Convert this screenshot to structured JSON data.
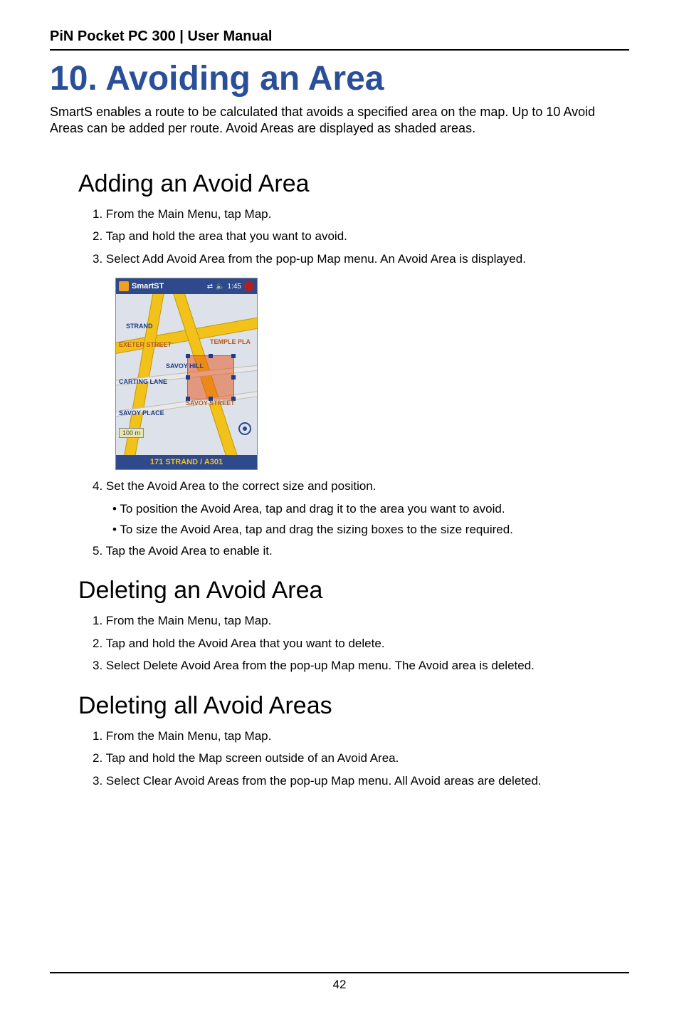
{
  "header": "PiN Pocket PC 300 | User Manual",
  "chapter_title": "10. Avoiding an Area",
  "intro": "SmartS enables a route to be calculated that avoids a specified area on the map. Up to 10 Avoid Areas can be added per route. Avoid Areas are displayed as shaded areas.",
  "sections": {
    "adding": {
      "title": "Adding an Avoid Area",
      "steps": [
        "1. From the Main Menu, tap Map.",
        "2. Tap and hold the area that you want to avoid.",
        "3. Select Add Avoid Area from the pop-up Map menu. An Avoid Area is displayed.",
        "4. Set the Avoid Area to the correct size and position.",
        "5. Tap the Avoid Area to enable it."
      ],
      "substeps": [
        "• To position the Avoid Area, tap and drag it to the area you want to avoid.",
        "• To size the Avoid Area, tap and drag the sizing boxes to the size required."
      ]
    },
    "deleting": {
      "title": "Deleting an Avoid Area",
      "steps": [
        "1. From the Main Menu, tap Map.",
        "2. Tap and hold the Avoid Area that you want to delete.",
        "3. Select Delete Avoid Area from the pop-up Map menu. The Avoid area is deleted."
      ]
    },
    "deleting_all": {
      "title": "Deleting all Avoid Areas",
      "steps": [
        "1. From the Main Menu, tap Map.",
        "2. Tap and hold the Map screen outside of an Avoid Area.",
        "3. Select Clear Avoid Areas from the pop-up Map menu. All Avoid areas are deleted."
      ]
    }
  },
  "screenshot": {
    "app_title": "SmartST",
    "clock": "1:45",
    "status_label": "A301",
    "scale_label": "100 m",
    "bottom_bar": "171 STRAND / A301",
    "street_labels": {
      "strand": "STRAND",
      "exeter": "EXETER STREET",
      "temple": "TEMPLE PLA",
      "savoy_hill": "SAVOY HILL",
      "carting": "CARTING LANE",
      "savoy_street": "SAVOY STREET",
      "savoy_place": "SAVOY PLACE"
    }
  },
  "page_number": "42"
}
